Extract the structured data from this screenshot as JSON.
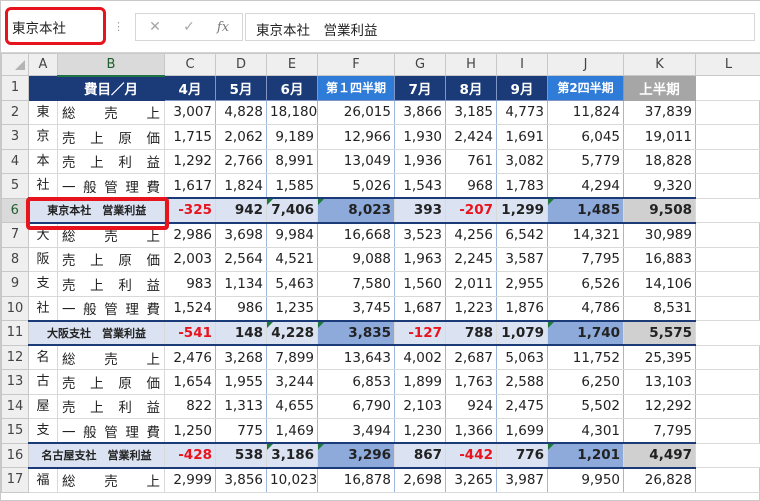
{
  "formula_bar": {
    "name_box": "東京本社",
    "separator": "⋮",
    "cancel_symbol": "✕",
    "enter_symbol": "✓",
    "fx_symbol": "fx",
    "content": "東京本社　営業利益"
  },
  "grid": {
    "corner": "",
    "columns": [
      "A",
      "B",
      "C",
      "D",
      "E",
      "F",
      "G",
      "H",
      "I",
      "J",
      "K",
      "L"
    ],
    "header_row": {
      "row_num": "1",
      "cells": [
        "",
        "費目／月",
        "4月",
        "5月",
        "6月",
        "第１四半期",
        "7月",
        "8月",
        "9月",
        "第2四半期",
        "上半期",
        ""
      ]
    },
    "rows": [
      {
        "row_num": "2",
        "branch": "東",
        "item": [
          "総",
          "売",
          "上"
        ],
        "values": [
          "3,007",
          "4,828",
          "18,180",
          "26,015",
          "3,866",
          "3,185",
          "4,773",
          "11,824",
          "37,839"
        ]
      },
      {
        "row_num": "3",
        "branch": "京",
        "item": [
          "売",
          "上",
          "原",
          "価"
        ],
        "values": [
          "1,715",
          "2,062",
          "9,189",
          "12,966",
          "1,930",
          "2,424",
          "1,691",
          "6,045",
          "19,011"
        ]
      },
      {
        "row_num": "4",
        "branch": "本",
        "item": [
          "売",
          "上",
          "利",
          "益"
        ],
        "values": [
          "1,292",
          "2,766",
          "8,991",
          "13,049",
          "1,936",
          "761",
          "3,082",
          "5,779",
          "18,828"
        ]
      },
      {
        "row_num": "5",
        "branch": "社",
        "item": [
          "一",
          "般",
          "管",
          "理",
          "費"
        ],
        "values": [
          "1,617",
          "1,824",
          "1,585",
          "5,026",
          "1,543",
          "968",
          "1,783",
          "4,294",
          "9,320"
        ]
      },
      {
        "row_num": "6",
        "profit": true,
        "label": "東京本社　営業利益",
        "values": [
          "-325",
          "942",
          "7,406",
          "8,023",
          "393",
          "-207",
          "1,299",
          "1,485",
          "9,508"
        ]
      },
      {
        "row_num": "7",
        "branch": "大",
        "item": [
          "総",
          "売",
          "上"
        ],
        "values": [
          "2,986",
          "3,698",
          "9,984",
          "16,668",
          "3,523",
          "4,256",
          "6,542",
          "14,321",
          "30,989"
        ]
      },
      {
        "row_num": "8",
        "branch": "阪",
        "item": [
          "売",
          "上",
          "原",
          "価"
        ],
        "values": [
          "2,003",
          "2,564",
          "4,521",
          "9,088",
          "1,963",
          "2,245",
          "3,587",
          "7,795",
          "16,883"
        ]
      },
      {
        "row_num": "9",
        "branch": "支",
        "item": [
          "売",
          "上",
          "利",
          "益"
        ],
        "values": [
          "983",
          "1,134",
          "5,463",
          "7,580",
          "1,560",
          "2,011",
          "2,955",
          "6,526",
          "14,106"
        ]
      },
      {
        "row_num": "10",
        "branch": "社",
        "item": [
          "一",
          "般",
          "管",
          "理",
          "費"
        ],
        "values": [
          "1,524",
          "986",
          "1,235",
          "3,745",
          "1,687",
          "1,223",
          "1,876",
          "4,786",
          "8,531"
        ]
      },
      {
        "row_num": "11",
        "profit": true,
        "label": "大阪支社　営業利益",
        "values": [
          "-541",
          "148",
          "4,228",
          "3,835",
          "-127",
          "788",
          "1,079",
          "1,740",
          "5,575"
        ]
      },
      {
        "row_num": "12",
        "branch": "名",
        "item": [
          "総",
          "売",
          "上"
        ],
        "values": [
          "2,476",
          "3,268",
          "7,899",
          "13,643",
          "4,002",
          "2,687",
          "5,063",
          "11,752",
          "25,395"
        ]
      },
      {
        "row_num": "13",
        "branch": "古",
        "item": [
          "売",
          "上",
          "原",
          "価"
        ],
        "values": [
          "1,654",
          "1,955",
          "3,244",
          "6,853",
          "1,899",
          "1,763",
          "2,588",
          "6,250",
          "13,103"
        ]
      },
      {
        "row_num": "14",
        "branch": "屋",
        "item": [
          "売",
          "上",
          "利",
          "益"
        ],
        "values": [
          "822",
          "1,313",
          "4,655",
          "6,790",
          "2,103",
          "924",
          "2,475",
          "5,502",
          "12,292"
        ]
      },
      {
        "row_num": "15",
        "branch": "支",
        "item": [
          "一",
          "般",
          "管",
          "理",
          "費"
        ],
        "values": [
          "1,250",
          "775",
          "1,469",
          "3,494",
          "1,230",
          "1,366",
          "1,699",
          "4,301",
          "7,795"
        ]
      },
      {
        "row_num": "15b",
        "hidden": true
      },
      {
        "row_num": "16",
        "profit": true,
        "label": "名古屋支社　営業利益",
        "values": [
          "-428",
          "538",
          "3,186",
          "3,296",
          "867",
          "-442",
          "776",
          "1,201",
          "4,497"
        ]
      },
      {
        "row_num": "17",
        "branch": "福",
        "item": [
          "総",
          "売",
          "上"
        ],
        "values": [
          "2,999",
          "3,856",
          "10,023",
          "16,878",
          "2,698",
          "3,265",
          "3,987",
          "9,950",
          "26,828"
        ]
      }
    ],
    "extra_branch_char": "社",
    "colors": {
      "header_dark": "#1a3b77",
      "header_quarter": "#2e7bd8",
      "header_half": "#a6a6a6",
      "profit_fill": "#dbe3f3",
      "quarter_fill": "#8eaadb",
      "negative": "#e8141d",
      "highlight": "#e8141d"
    }
  }
}
